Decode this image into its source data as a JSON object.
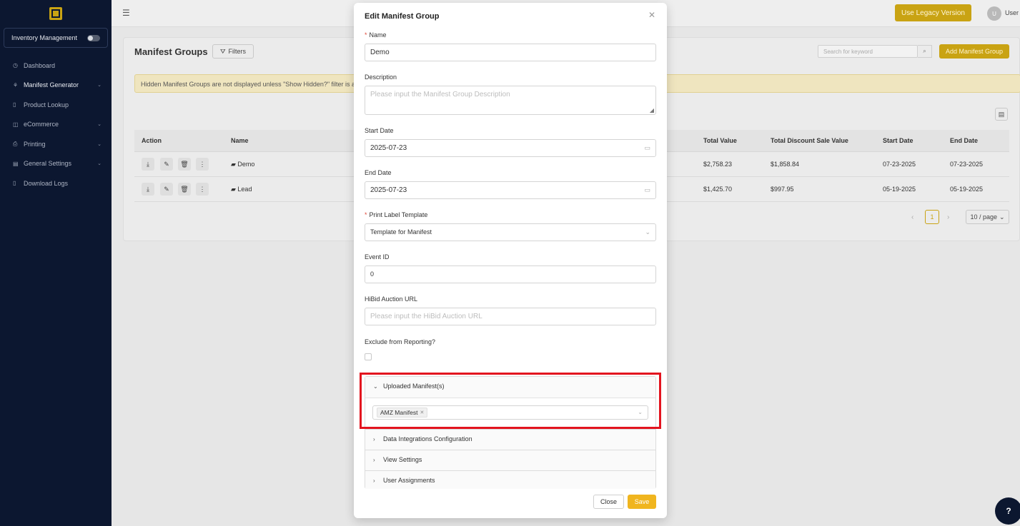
{
  "sidebar": {
    "module_label": "Inventory Management",
    "items": [
      {
        "icon": "dashboard-icon",
        "glyph": "◷",
        "label": "Dashboard"
      },
      {
        "icon": "hierarchy-icon",
        "glyph": "⚘",
        "label": "Manifest Generator",
        "chevron": "⌄"
      },
      {
        "icon": "file-icon",
        "glyph": "▯",
        "label": "Product Lookup"
      },
      {
        "icon": "bag-icon",
        "glyph": "◫",
        "label": "eCommerce",
        "chevron": "⌄"
      },
      {
        "icon": "printer-icon",
        "glyph": "⎙",
        "label": "Printing",
        "chevron": "⌄"
      },
      {
        "icon": "settings-icon",
        "glyph": "▤",
        "label": "General Settings",
        "chevron": "⌄"
      },
      {
        "icon": "file-icon",
        "glyph": "▯",
        "label": "Download Logs"
      }
    ]
  },
  "topbar": {
    "legacy_label": "Use Legacy Version",
    "avatar_initial": "U",
    "user_label": "User"
  },
  "page": {
    "title": "Manifest Groups",
    "filters_label": "Filters",
    "search_placeholder": "Search for keyword",
    "add_label": "Add Manifest Group",
    "notice": "Hidden Manifest Groups are not displayed unless \"Show Hidden?\" filter is app",
    "columns": {
      "action": "Action",
      "name": "Name",
      "total_value": "Total Value",
      "total_discount": "Total Discount Sale Value",
      "start_date": "Start Date",
      "end_date": "End Date"
    },
    "rows": [
      {
        "name": "Demo",
        "total_value": "$2,758.23",
        "discount": "$1,858.84",
        "start": "07-23-2025",
        "end": "07-23-2025"
      },
      {
        "name": "Lead",
        "total_value": "$1,425.70",
        "discount": "$997.95",
        "start": "05-19-2025",
        "end": "05-19-2025"
      }
    ],
    "pager": {
      "current": "1",
      "page_size": "10 / page"
    }
  },
  "modal": {
    "title": "Edit Manifest Group",
    "name_label": "Name",
    "name_value": "Demo",
    "description_label": "Description",
    "description_placeholder": "Please input the Manifest Group Description",
    "start_label": "Start Date",
    "start_value": "2025-07-23",
    "end_label": "End Date",
    "end_value": "2025-07-23",
    "template_label": "Print Label Template",
    "template_value": "Template for Manifest",
    "event_label": "Event ID",
    "event_value": "0",
    "hibid_label": "HiBid Auction URL",
    "hibid_placeholder": "Please input the HiBid Auction URL",
    "exclude_label": "Exclude from Reporting?",
    "panels": {
      "uploaded": "Uploaded Manifest(s)",
      "uploaded_tag": "AMZ Manifest",
      "data": "Data Integrations Configuration",
      "view": "View Settings",
      "users": "User Assignments"
    },
    "close_label": "Close",
    "save_label": "Save"
  },
  "help_label": "?",
  "colors": {
    "sidebar": "#0c1730",
    "accent": "#c9a313",
    "save": "#f0b51e",
    "highlight": "#e3141f"
  }
}
